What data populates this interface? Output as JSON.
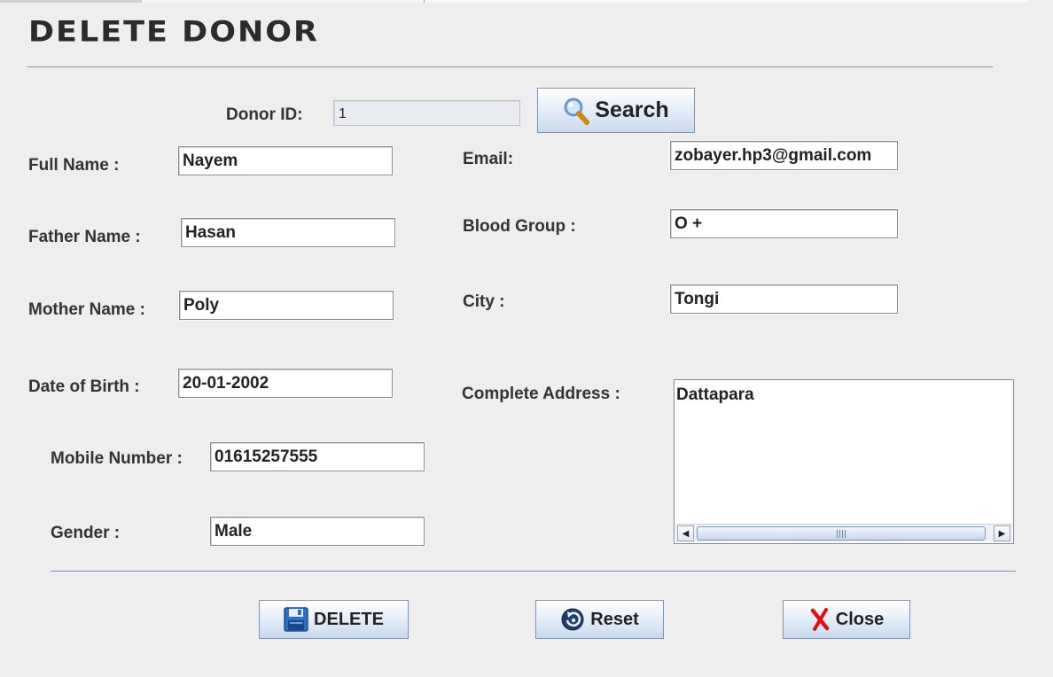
{
  "page": {
    "title": "DELETE DONOR"
  },
  "search": {
    "donor_id_label": "Donor ID:",
    "donor_id_value": "1",
    "search_label": "Search"
  },
  "form": {
    "full_name": {
      "label": "Full Name :",
      "value": "Nayem"
    },
    "father_name": {
      "label": "Father Name :",
      "value": "Hasan"
    },
    "mother_name": {
      "label": "Mother Name :",
      "value": "Poly"
    },
    "date_of_birth": {
      "label": "Date of Birth :",
      "value": "20-01-2002"
    },
    "mobile_number": {
      "label": "Mobile Number :",
      "value": "01615257555"
    },
    "gender": {
      "label": "Gender :",
      "value": "Male"
    },
    "email": {
      "label": "Email:",
      "value": "zobayer.hp3@gmail.com"
    },
    "blood_group": {
      "label": "Blood Group :",
      "value": "O +"
    },
    "city": {
      "label": "City :",
      "value": "Tongi"
    },
    "address": {
      "label": "Complete Address :",
      "value": "Dattapara"
    }
  },
  "actions": {
    "delete_label": "DELETE",
    "reset_label": "Reset",
    "close_label": "Close"
  },
  "icons": {
    "search": "magnifier-icon",
    "delete": "floppy-disk-icon",
    "reset": "reset-icon",
    "close": "red-x-icon"
  },
  "colors": {
    "background": "#eeeeee",
    "separator": "#7d8fb5",
    "button_top": "#ffffff",
    "button_bottom": "#c9d9ee",
    "close_x": "#e01010"
  }
}
